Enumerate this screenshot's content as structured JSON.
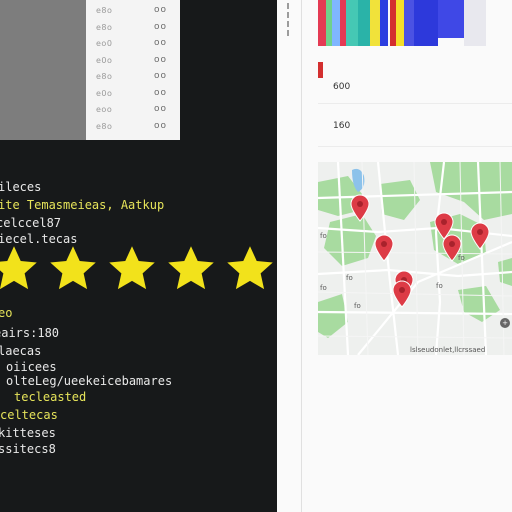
{
  "list_panel": {
    "rows": [
      {
        "text": "e8o",
        "icon": "oo"
      },
      {
        "text": "e8o",
        "icon": "oo"
      },
      {
        "text": "eo0",
        "icon": "oo"
      },
      {
        "text": "e0o",
        "icon": "oo"
      },
      {
        "text": "e8o",
        "icon": "oo"
      },
      {
        "text": "e0o",
        "icon": "oo"
      },
      {
        "text": "eoo",
        "icon": "oo"
      },
      {
        "text": "e8o",
        "icon": "oo"
      }
    ]
  },
  "editor": {
    "lines": [
      {
        "text": "ileces",
        "color": "#e8e8e8"
      },
      {
        "text": "ite  Temasmeieas, Aatkup",
        "color": "#e6e45a"
      },
      {
        "text": "celccel87",
        "color": "#e8e8e8"
      },
      {
        "text": "iecel.tecas",
        "color": "#e8e8e8"
      },
      {
        "text": "eo",
        "color": "#e6e45a"
      },
      {
        "text": "eairs:180",
        "color": "#e8e8e8"
      },
      {
        "text": "laecas",
        "color": "#e8e8e8"
      },
      {
        "text": "oiicees",
        "color": "#e8e8e8"
      },
      {
        "text": "olteLeg/ueekeicebamares",
        "color": "#e8e8e8"
      },
      {
        "text": "tecleasted",
        "color": "#e6e45a"
      },
      {
        "text": "celtecas",
        "color": "#e6e45a"
      },
      {
        "text": "kitteses",
        "color": "#e8e8e8"
      },
      {
        "text": "ssitecs8",
        "color": "#e8e8e8"
      }
    ],
    "rating": 5,
    "star_color": "#f2e21b"
  },
  "stats": {
    "value_1": "600",
    "value_2": "160"
  },
  "bar_strip": {
    "colors": [
      "#e43a53",
      "#6fd18c",
      "#7fb6ff",
      "#e43a53",
      "#45c8b4",
      "#2ab3a8",
      "#f1e23a",
      "#2c3ee0",
      "#d32f2f",
      "#f5df2a",
      "#4b52e3",
      "#2d39db",
      "#3f48e6"
    ]
  },
  "map": {
    "labels": [
      {
        "text": "fo"
      },
      {
        "text": "fo"
      },
      {
        "text": "fo"
      },
      {
        "text": "fo"
      },
      {
        "text": "fo"
      },
      {
        "text": "fo"
      }
    ],
    "footer": "lslseudonlet,llcrssaed",
    "pin_color": "#dd3b46",
    "park_color": "#a8dba0",
    "water_color": "#8cc2ea"
  }
}
